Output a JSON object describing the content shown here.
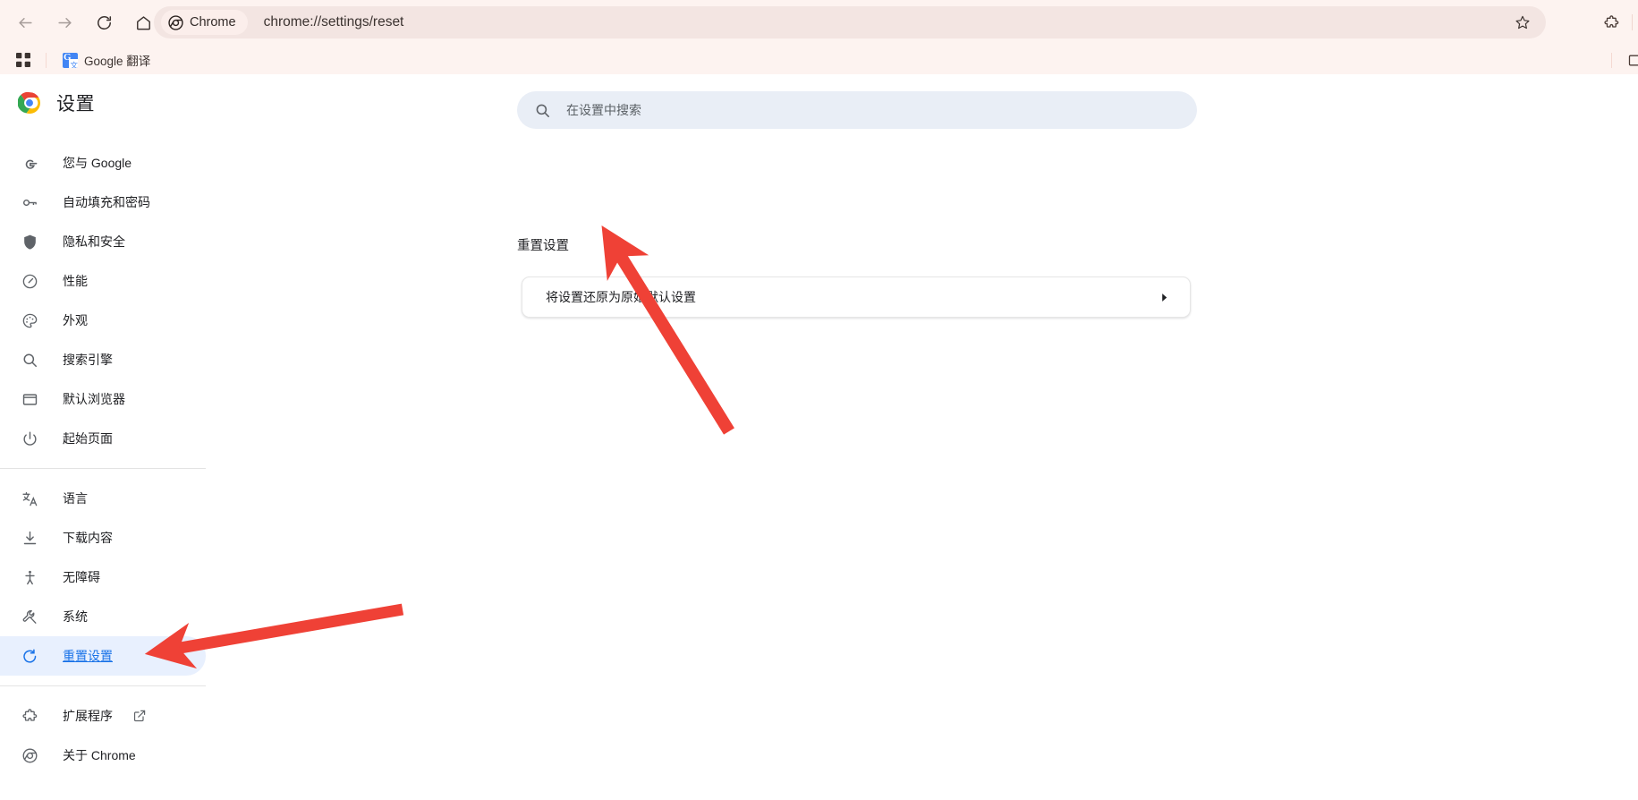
{
  "browser": {
    "nav": {
      "back_tooltip": "后退",
      "forward_tooltip": "前进",
      "reload_tooltip": "重新加载",
      "home_tooltip": "主页"
    },
    "omnibox": {
      "chip_label": "Chrome",
      "url": "chrome://settings/reset",
      "star_tooltip": "收藏此标签页",
      "extensions_tooltip": "扩展程序"
    },
    "bookmarks": {
      "apps_tooltip": "应用",
      "items": [
        {
          "label": "Google 翻译",
          "icon": "google-translate-icon",
          "badge": "G"
        }
      ],
      "overflow_tooltip": "所有书签"
    }
  },
  "sidebar": {
    "title": "设置",
    "logo": "chrome-logo-icon",
    "groups": [
      {
        "items": [
          {
            "label": "您与 Google",
            "icon": "google-g-icon",
            "active": false
          },
          {
            "label": "自动填充和密码",
            "icon": "key-icon",
            "active": false
          },
          {
            "label": "隐私和安全",
            "icon": "shield-icon",
            "active": false
          },
          {
            "label": "性能",
            "icon": "speedometer-icon",
            "active": false
          },
          {
            "label": "外观",
            "icon": "palette-icon",
            "active": false
          },
          {
            "label": "搜索引擎",
            "icon": "search-icon",
            "active": false
          },
          {
            "label": "默认浏览器",
            "icon": "window-icon",
            "active": false
          },
          {
            "label": "起始页面",
            "icon": "power-icon",
            "active": false
          }
        ]
      },
      {
        "items": [
          {
            "label": "语言",
            "icon": "translate-icon",
            "active": false
          },
          {
            "label": "下载内容",
            "icon": "download-icon",
            "active": false
          },
          {
            "label": "无障碍",
            "icon": "accessibility-icon",
            "active": false
          },
          {
            "label": "系统",
            "icon": "wrench-icon",
            "active": false
          },
          {
            "label": "重置设置",
            "icon": "reset-icon",
            "active": true
          }
        ]
      },
      {
        "items": [
          {
            "label": "扩展程序",
            "icon": "puzzle-icon",
            "active": false,
            "external": true
          },
          {
            "label": "关于 Chrome",
            "icon": "chrome-outline-icon",
            "active": false
          }
        ]
      }
    ]
  },
  "main": {
    "search": {
      "placeholder": "在设置中搜索",
      "value": "",
      "icon": "search-icon"
    },
    "section_title": "重置设置",
    "reset_card": {
      "label": "将设置还原为原始默认设置",
      "chevron": "chevron-right-icon"
    }
  },
  "annotations": {
    "accent_color": "#ef4136",
    "arrows": [
      {
        "name": "arrow-to-reset-card",
        "points_to": "将设置还原为原始默认设置"
      },
      {
        "name": "arrow-to-sidebar-reset",
        "points_to": "重置设置"
      }
    ]
  },
  "colors": {
    "browser_chrome_bg": "#fdf3f0",
    "omnibox_bg": "#f3e5e2",
    "accent_blue": "#1a73e8",
    "active_item_bg": "#e8f0fe",
    "search_bg": "#e9eef6",
    "annotation_red": "#ef4136"
  }
}
